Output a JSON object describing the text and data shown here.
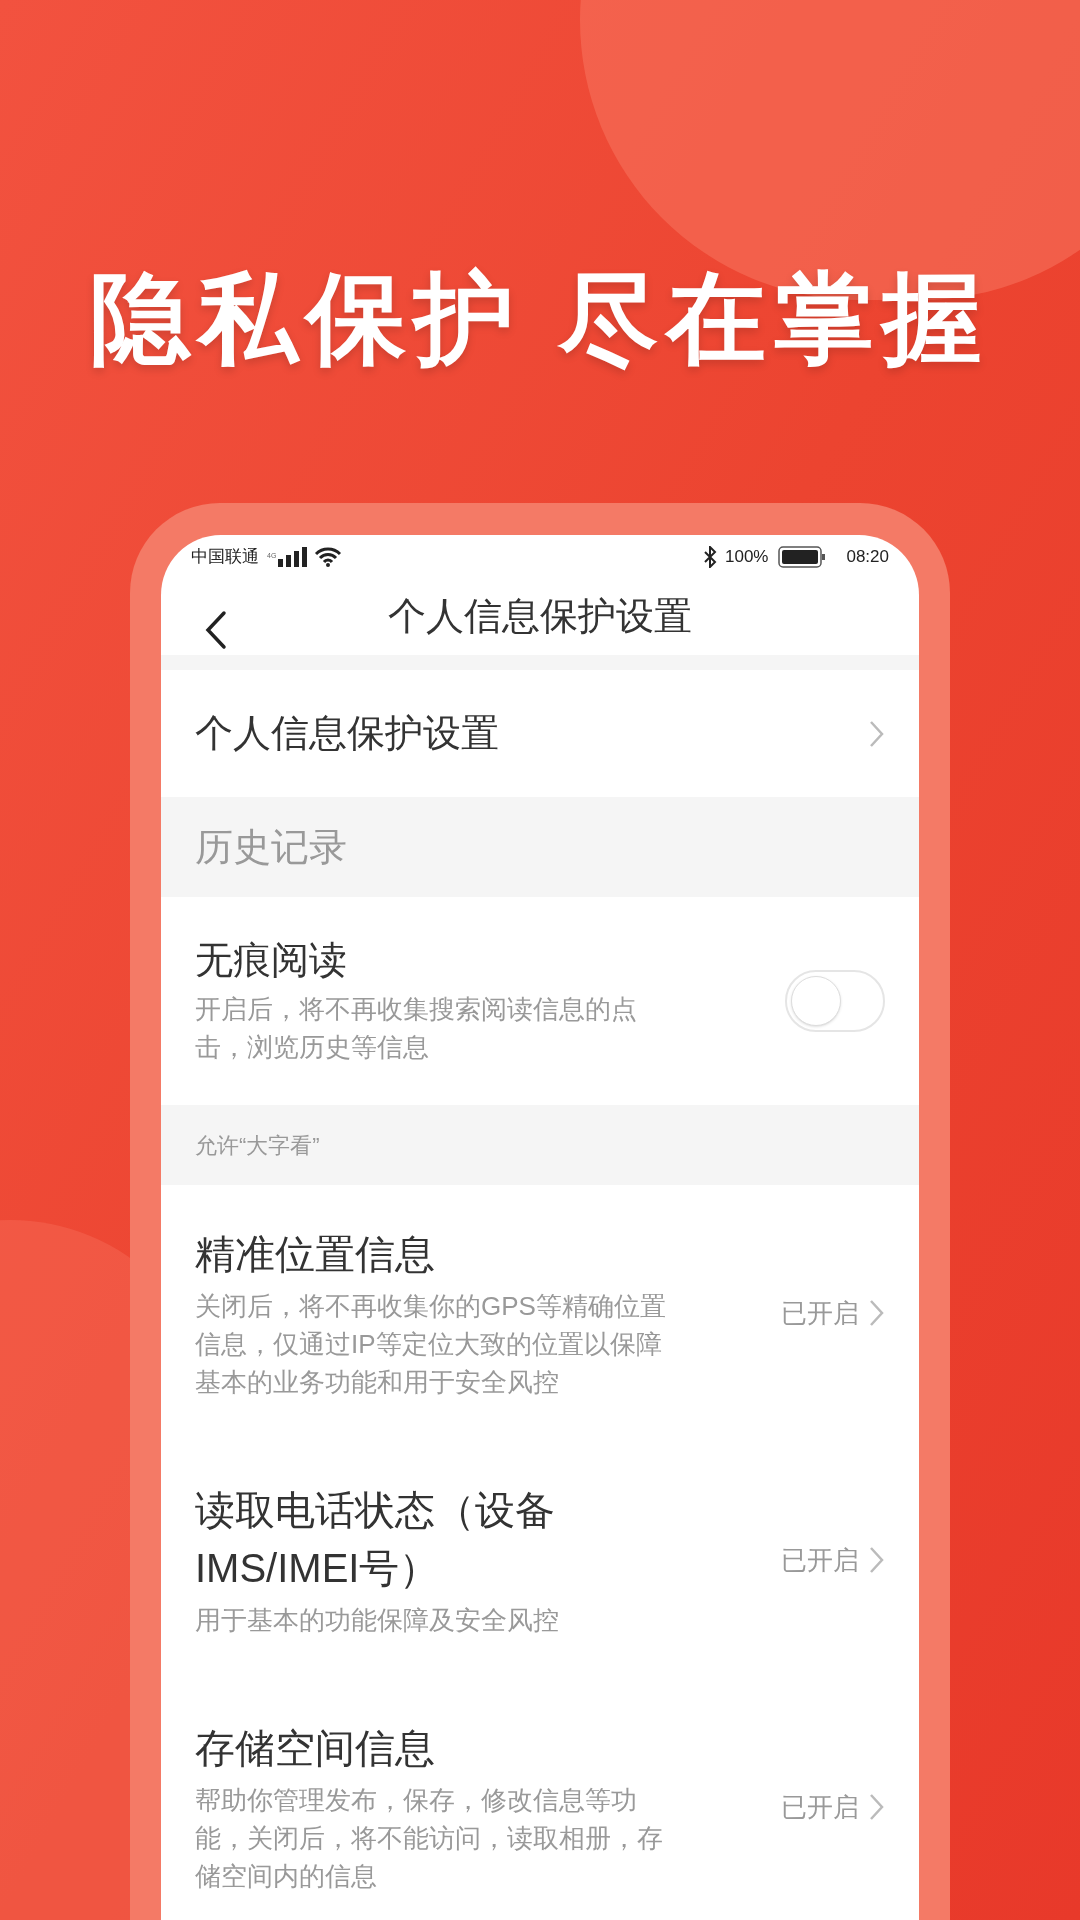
{
  "headline": "隐私保护 尽在掌握",
  "status_bar": {
    "carrier": "中国联通",
    "network": "4G",
    "battery": "100%",
    "time": "08:20"
  },
  "nav": {
    "title": "个人信息保护设置"
  },
  "sections": [
    {
      "kind": "rows",
      "items": [
        {
          "kind": "link",
          "title": "个人信息保护设置"
        }
      ]
    },
    {
      "kind": "header_large",
      "title": "历史记录"
    },
    {
      "kind": "rows",
      "items": [
        {
          "kind": "toggle",
          "title": "无痕阅读",
          "description": "开启后，将不再收集搜索阅读信息的点击，浏览历史等信息",
          "on": false
        }
      ]
    },
    {
      "kind": "header_small",
      "title": "允许“大字看”"
    },
    {
      "kind": "rows",
      "items": [
        {
          "kind": "status",
          "title": "精准位置信息",
          "description": "关闭后，将不再收集你的GPS等精确位置信息，仅通过IP等定位大致的位置以保障基本的业务功能和用于安全风控",
          "value": "已开启"
        },
        {
          "kind": "status",
          "title": "读取电话状态（设备IMS/IMEI号）",
          "description": "用于基本的功能保障及安全风控",
          "value": "已开启"
        },
        {
          "kind": "status",
          "title": "存储空间信息",
          "description": "帮助你管理发布，保存，修改信息等功能，关闭后，将不能访问，读取相册，存储空间内的信息",
          "value": "已开启"
        }
      ]
    }
  ]
}
